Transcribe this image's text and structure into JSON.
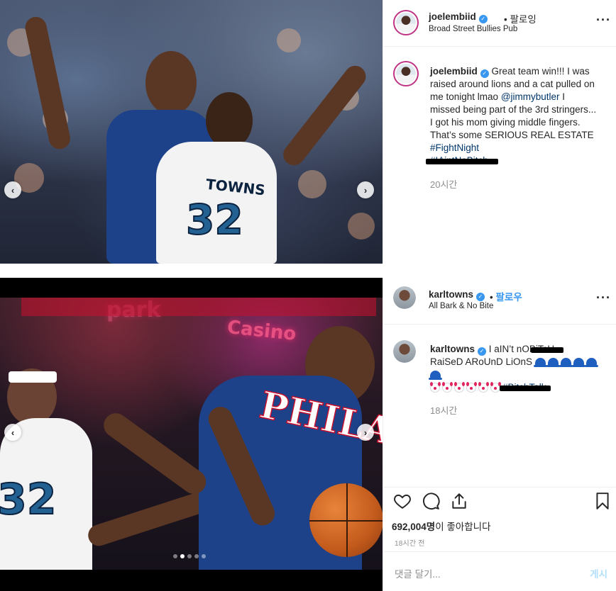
{
  "post1": {
    "username": "joelembiid",
    "follow_sep": "•",
    "follow_label": "팔로잉",
    "location": "Broad Street Bullies Pub",
    "more_icon": "more-icon",
    "caption_user": "joelembiid",
    "caption_text_1": "Great team win!!! I was raised around lions and a cat pulled on me tonight lmao ",
    "mention": "@jimmybutler",
    "caption_text_2": " I missed being part of the 3rd stringers... I got his mom giving middle fingers. That’s some SERIOUS REAL ESTATE ",
    "hashtag": "#FightNight",
    "hashtag_redacted": "#IAintNoBitch",
    "time_ago": "20시간",
    "image": {
      "jersey_name": "TOWNS",
      "jersey_number": "32"
    }
  },
  "post2": {
    "username": "karltowns",
    "follow_sep": "•",
    "follow_label": "팔로우",
    "location": "All Bark & No Bite",
    "caption_user": "karltowns",
    "caption_text_1": "I aIN’t nO",
    "caption_redacted_1": "BiTcH",
    "caption_text_2": "RaiSeD ARoUnD LiOnS",
    "cap_count": 6,
    "clown_count": 6,
    "caption_redacted_2": "#BitchTalk",
    "time_ago": "18시간",
    "likes_count": "692,004명",
    "likes_suffix": "이 좋아합니다",
    "post_time": "18시간 전",
    "comment_placeholder": "댓글 달기...",
    "post_button": "게시",
    "image": {
      "jersey_word": "PHILA",
      "sign_1": "park",
      "sign_2": "Casino",
      "number_left": "32",
      "carousel_dots": 5,
      "carousel_active": 2
    }
  },
  "colors": {
    "verified": "#3897f0",
    "link": "#003569",
    "muted": "#8e8e8e",
    "sixers_blue": "#1d428a",
    "wolves_navy": "#0c2340"
  }
}
